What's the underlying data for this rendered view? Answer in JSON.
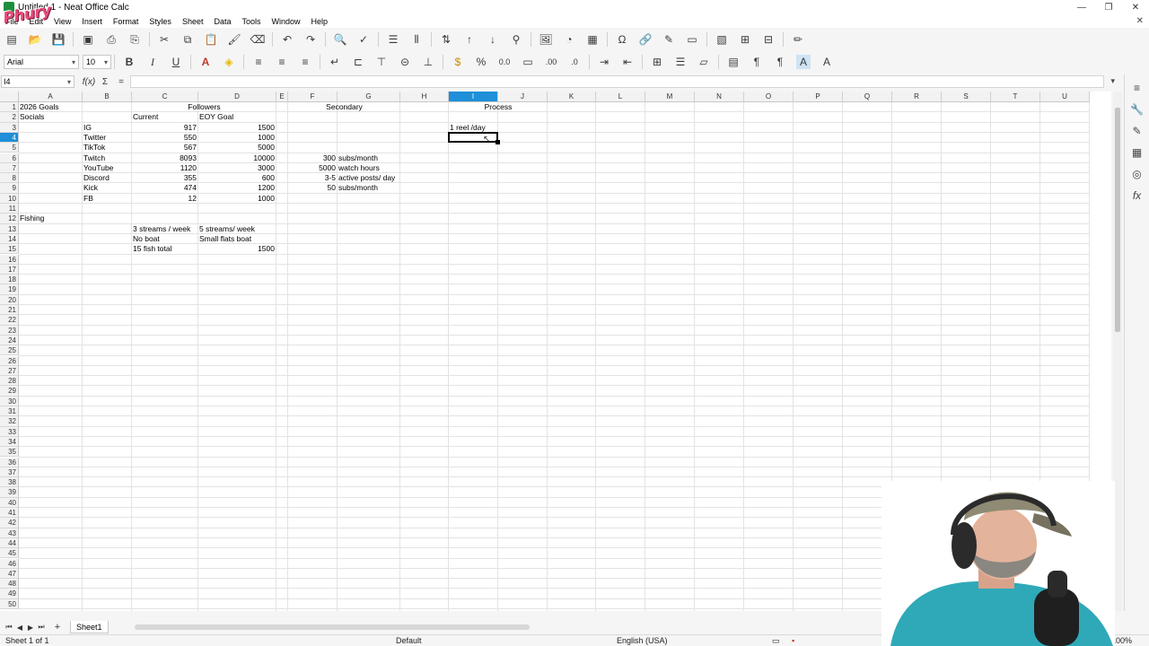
{
  "window": {
    "title": "Untitled 1 - Neat Office Calc",
    "controls": [
      "—",
      "❐",
      "✕"
    ]
  },
  "logo": {
    "text": "Phury"
  },
  "menu": [
    "File",
    "Edit",
    "View",
    "Insert",
    "Format",
    "Styles",
    "Sheet",
    "Data",
    "Tools",
    "Window",
    "Help"
  ],
  "format_bar": {
    "font_name": "Arial",
    "font_size": "10",
    "bold": "B",
    "italic": "I",
    "underline": "U",
    "percent": "%",
    "decimal": "0.0"
  },
  "formula_bar": {
    "name_box": "I4",
    "fx": "f(x)",
    "sum": "Σ",
    "equals": "="
  },
  "columns": [
    "A",
    "B",
    "C",
    "D",
    "E",
    "F",
    "G",
    "H",
    "I",
    "J",
    "K",
    "L",
    "M",
    "N",
    "O",
    "P",
    "Q",
    "R",
    "S",
    "T",
    "U"
  ],
  "active_column": "I",
  "active_row": "4",
  "cells": {
    "A1": "2026 Goals",
    "A2": "Socials",
    "A12": "Fishing",
    "CD1": "Followers",
    "C2": "Current",
    "D2": "EOY Goal",
    "FG1": "Secondary",
    "IJ1": "Process",
    "B3": "IG",
    "C3": "917",
    "D3": "1500",
    "B4": "Twitter",
    "C4": "550",
    "D4": "1000",
    "B5": "TikTok",
    "C5": "567",
    "D5": "5000",
    "B6": "Twitch",
    "C6": "8093",
    "D6": "10000",
    "F6": "300",
    "G6": "subs/month",
    "B7": "YouTube",
    "C7": "1120",
    "D7": "3000",
    "F7": "5000",
    "G7": "watch hours",
    "B8": "Discord",
    "C8": "355",
    "D8": "600",
    "F8": "3-5",
    "G8": "active posts/ day",
    "B9": "Kick",
    "C9": "474",
    "D9": "1200",
    "F9": "50",
    "G9": "subs/month",
    "B10": "FB",
    "C10": "12",
    "D10": "1000",
    "I3": "1 reel /day",
    "C13": "3 streams / week",
    "D13": "5 streams/ week",
    "C14": "No boat",
    "D14": "Small flats boat",
    "C15": "15 fish total",
    "D15": "1500"
  },
  "tabs": {
    "sheet1": "Sheet1"
  },
  "status": {
    "sheet_info": "Sheet 1 of 1",
    "page_style": "Default",
    "language": "English (USA)",
    "zoom": "100%"
  },
  "colors": {
    "accent": "#1e8fd8",
    "grid": "#e3e3e3",
    "chrome": "#f5f5f5"
  }
}
